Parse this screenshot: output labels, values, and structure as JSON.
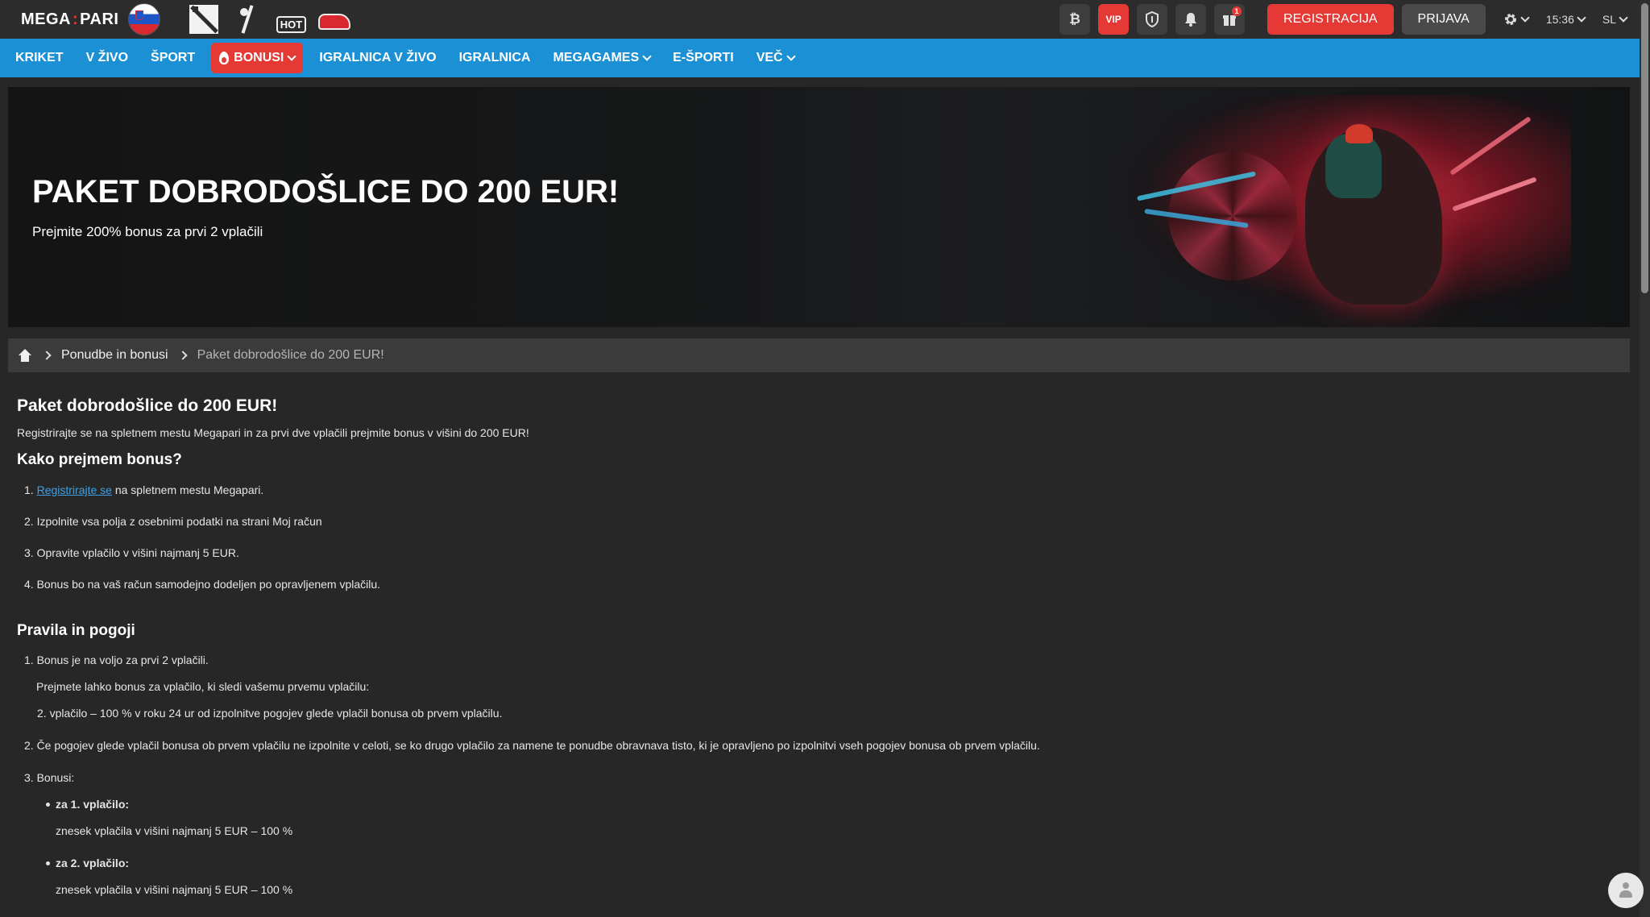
{
  "header": {
    "logo_left": "MEGA",
    "logo_sep": ":",
    "logo_right": "PARI",
    "game_icons": [
      "dota-icon",
      "cricket-icon",
      "hot-games-icon",
      "racing-car-icon"
    ],
    "hot_label": "HOT",
    "btc_symbol": "₿",
    "vip_label": "VIP",
    "gift_badge": "1",
    "register_label": "REGISTRACIJA",
    "login_label": "PRIJAVA",
    "time": "15:36",
    "language": "SL"
  },
  "nav": {
    "items": [
      "KRIKET",
      "V ŽIVO",
      "ŠPORT",
      "BONUSI",
      "IGRALNICA V ŽIVO",
      "IGRALNICA",
      "MEGAGAMES",
      "E-ŠPORTI",
      "VEČ"
    ]
  },
  "banner": {
    "title": "PAKET DOBRODOŠLICE DO 200 EUR!",
    "subtitle": "Prejmite 200% bonus za prvi 2 vplačili"
  },
  "breadcrumb": {
    "items": [
      "Ponudbe in bonusi",
      "Paket dobrodošlice do 200 EUR!"
    ]
  },
  "content": {
    "title": "Paket dobrodošlice do 200 EUR!",
    "intro": "Registrirajte se na spletnem mestu Megapari in za prvi dve vplačili prejmite bonus v višini do 200 EUR!",
    "how_title": "Kako prejmem bonus?",
    "step1_num": "1.",
    "step1_link": "Registrirajte se",
    "step1_rest": " na spletnem mestu Megapari.",
    "step2": "2. Izpolnite vsa polja z osebnimi podatki na strani Moj račun",
    "step3": "3. Opravite vplačilo v višini najmanj 5 EUR.",
    "step4": "4. Bonus bo na vaš račun samodejno dodeljen po opravljenem vplačilu.",
    "rules_title": "Pravila in pogoji",
    "rule1": "1. Bonus je na voljo za prvi 2 vplačili.",
    "rule1_sub1": "Prejmete lahko bonus za vplačilo, ki sledi vašemu prvemu vplačilu:",
    "rule1_sub2": "2. vplačilo – 100 % v roku 24 ur od izpolnitve pogojev glede vplačil bonusa ob prvem vplačilu.",
    "rule2": "2. Če pogojev glede vplačil bonusa ob prvem vplačilu ne izpolnite v celoti, se ko drugo vplačilo za namene te ponudbe obravnava tisto, ki je opravljeno po izpolnitvi vseh pogojev bonusa ob prvem vplačilu.",
    "rule3": "3. Bonusi:",
    "bonus1_label": "za 1. vplačilo:",
    "bonus1_value": "znesek vplačila v višini najmanj 5 EUR – 100 %",
    "bonus2_label": "za 2. vplačilo:",
    "bonus2_value": "znesek vplačila v višini najmanj 5 EUR – 100 %"
  },
  "colors": {
    "accent_red": "#e53935",
    "nav_blue": "#1c90d4",
    "background": "#272727",
    "link": "#3ea2e8"
  }
}
